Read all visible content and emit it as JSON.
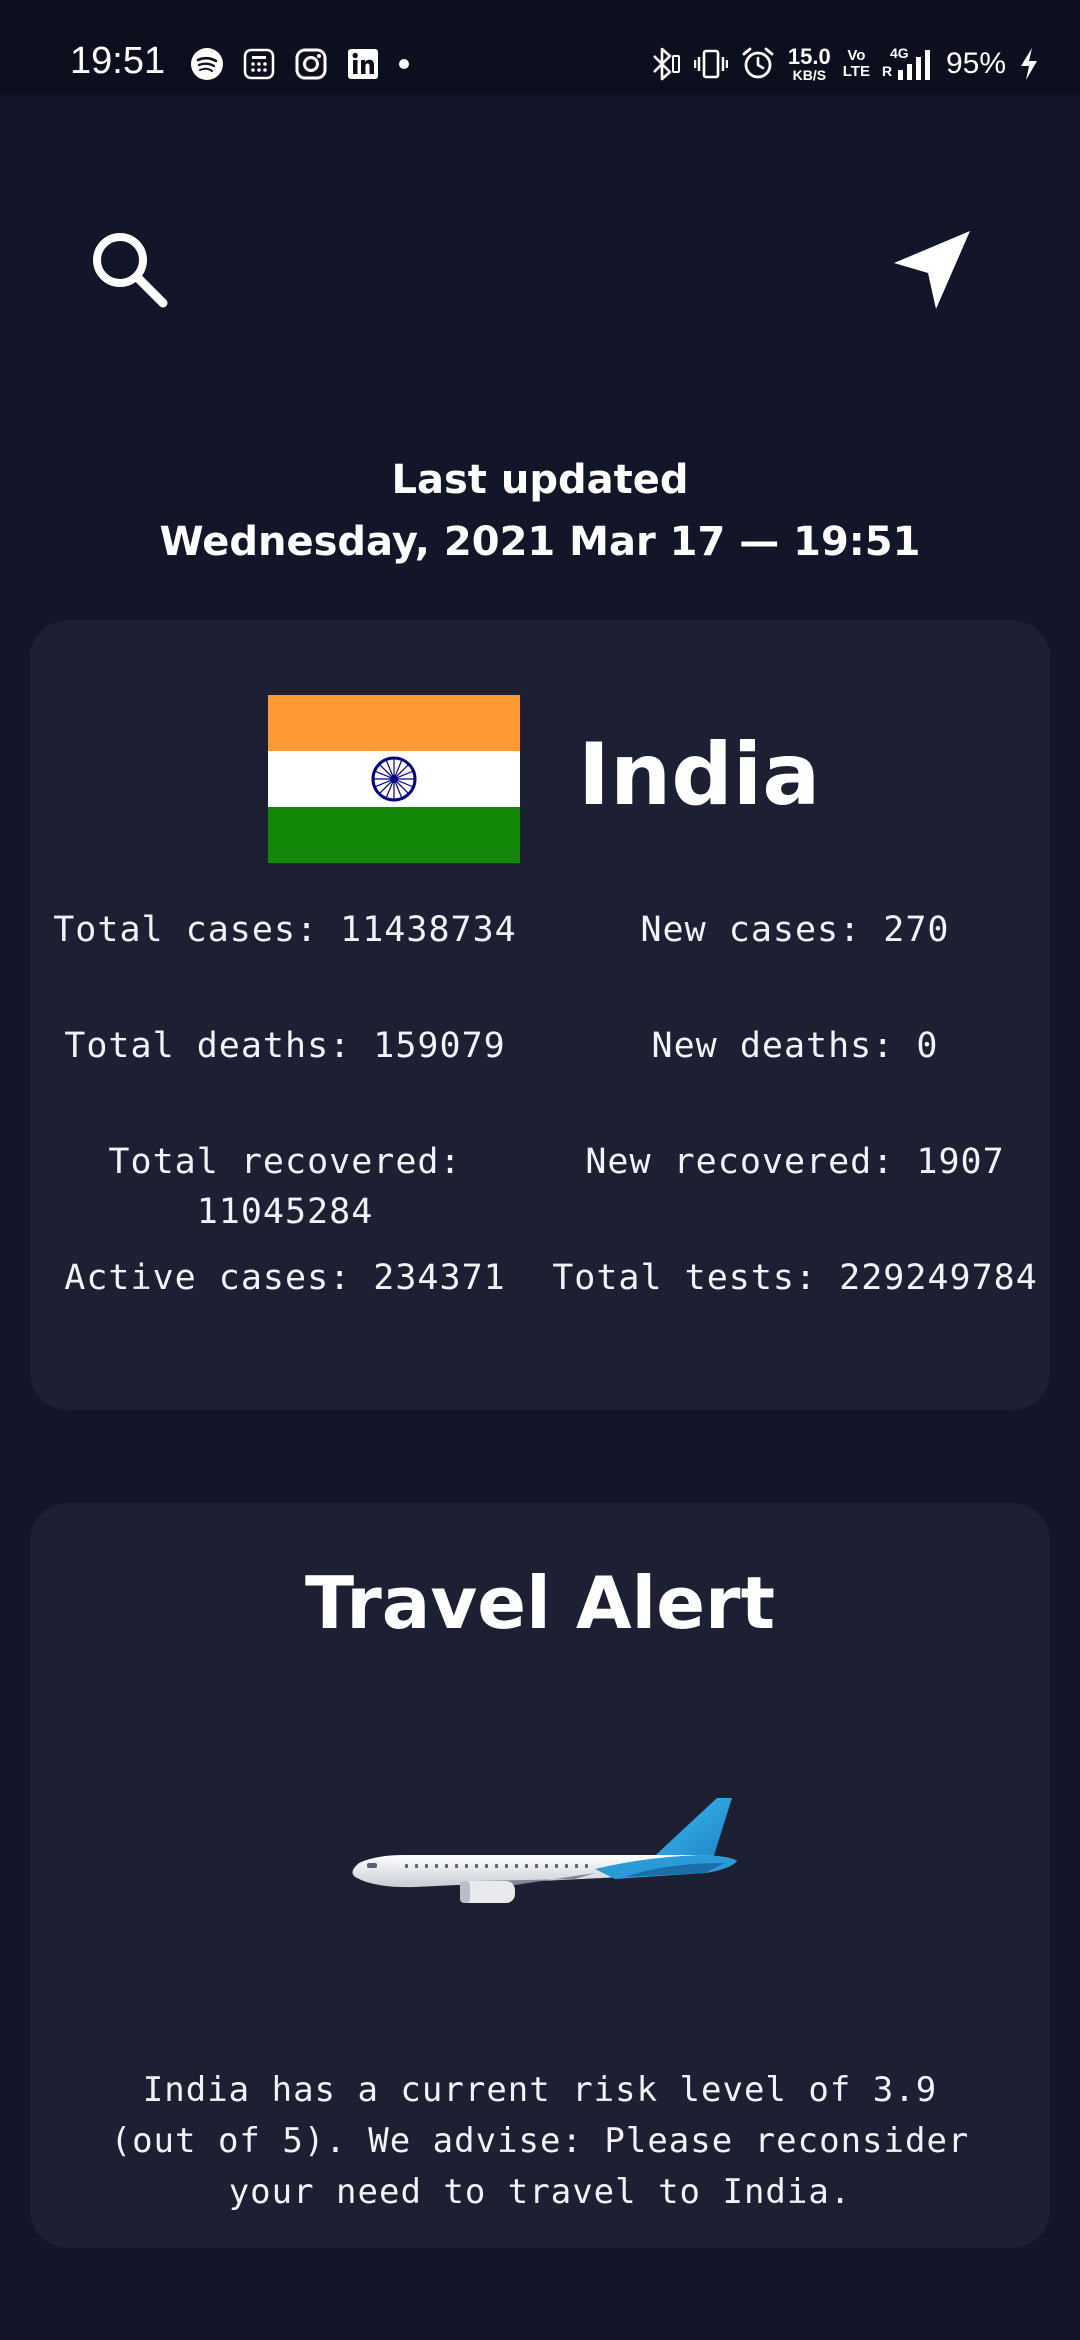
{
  "status_bar": {
    "time": "19:51",
    "network_speed": "15.0",
    "network_unit": "KB/S",
    "volte_top": "Vo",
    "volte_bottom": "LTE",
    "network_type": "4G",
    "roaming": "R",
    "battery": "95%",
    "notification_icons": [
      "spotify-icon",
      "calculator-icon",
      "instagram-icon",
      "linkedin-icon",
      "dot-icon"
    ],
    "system_icons": [
      "bluetooth-icon",
      "vibrate-icon",
      "alarm-icon",
      "signal-icon",
      "charging-icon"
    ]
  },
  "toolbar": {
    "search_icon": "search-icon",
    "location_icon": "navigation-arrow-icon"
  },
  "last_updated": {
    "label": "Last updated",
    "datetime": "Wednesday, 2021 Mar 17 — 19:51"
  },
  "country": {
    "name": "India",
    "flag_colors": {
      "saffron": "#FF9933",
      "white": "#FFFFFF",
      "green": "#138808",
      "chakra": "#000080"
    },
    "stats": {
      "total_cases": "Total cases: 11438734",
      "new_cases": "New cases: 270",
      "total_deaths": "Total deaths: 159079",
      "new_deaths": "New deaths: 0",
      "total_recovered": "Total recovered: 11045284",
      "new_recovered": "New recovered: 1907",
      "active_cases": "Active cases: 234371",
      "total_tests": "Total tests: 229249784"
    }
  },
  "travel_alert": {
    "title": "Travel Alert",
    "advice": "India has a current risk level of 3.9 (out of 5). We advise: Please reconsider your need to travel to India."
  },
  "colors": {
    "background": "#131628",
    "card": "#1d1f33",
    "text": "#ffffff"
  }
}
